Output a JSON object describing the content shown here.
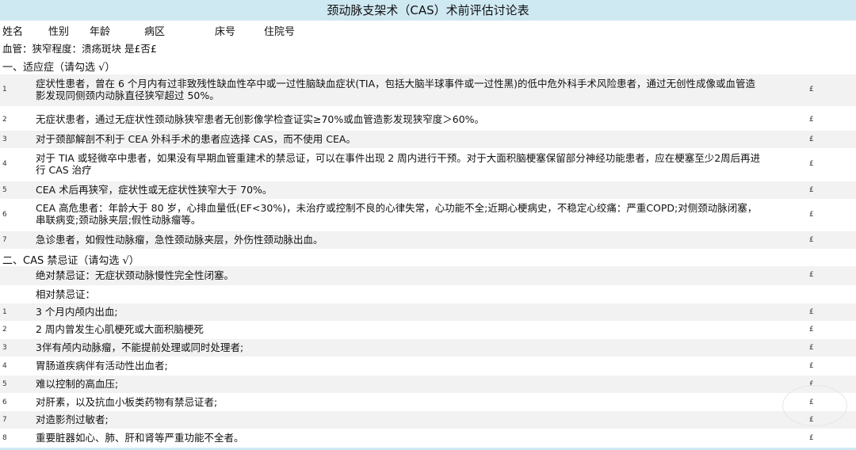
{
  "title": "颈动脉支架术（CAS）术前评估讨论表",
  "header": {
    "name": "姓名",
    "gender": "性别",
    "age": "年龄",
    "ward": "病区",
    "bed": "床号",
    "admission": "住院号"
  },
  "vessel_line": "血管：狭窄程度：溃疡斑块 是£否£",
  "indications": {
    "heading": "一、适应症（请勾选 √）",
    "items": [
      {
        "num": "1",
        "text": "症状性患者，曾在 6 个月内有过非致残性缺血性卒中或一过性脑缺血症状(TIA，包括大脑半球事件或一过性黑)的低中危外科手术风险患者，通过无创性成像或血管造影发现同侧颈内动脉直径狭窄超过 50%。",
        "check": "£"
      },
      {
        "num": "2",
        "text": "无症状患者，通过无症状性颈动脉狭窄患者无创影像学检查证实≥70%或血管造影发现狭窄度＞60%。",
        "check": "£"
      },
      {
        "num": "3",
        "text": "对于颈部解剖不利于 CEA 外科手术的患者应选择 CAS，而不使用 CEA。",
        "check": "£"
      },
      {
        "num": "4",
        "text": "对于 TIA 或轻微卒中患者，如果没有早期血管重建术的禁忌证，可以在事件出现 2 周内进行干预。对于大面积脑梗塞保留部分神经功能患者，应在梗塞至少2周后再进行 CAS 治疗",
        "check": "£"
      },
      {
        "num": "5",
        "text": "CEA 术后再狭窄，症状性或无症状性狭窄大于 70%。",
        "check": "£"
      },
      {
        "num": "6",
        "text": "CEA 高危患者：年龄大于 80 岁，心排血量低(EF<30%)，未治疗或控制不良的心律失常，心功能不全;近期心梗病史，不稳定心绞痛：严重COPD;对侧颈动脉闭塞，串联病变;颈动脉夹层;假性动脉瘤等。",
        "check": "£"
      },
      {
        "num": "7",
        "text": "急诊患者，如假性动脉瘤，急性颈动脉夹层，外伤性颈动脉出血。",
        "check": "£"
      }
    ]
  },
  "contraindications": {
    "heading": "二、CAS 禁忌证（请勾选 √）",
    "absolute": {
      "text": "绝对禁忌证：无症状颈动脉慢性完全性闭塞。",
      "check": "£"
    },
    "relative_label": "相对禁忌证：",
    "items": [
      {
        "num": "1",
        "text": "3 个月内颅内出血;",
        "check": "£"
      },
      {
        "num": "2",
        "text": "2 周内曾发生心肌梗死或大面积脑梗死",
        "check": "£"
      },
      {
        "num": "3",
        "text": "3伴有颅内动脉瘤，不能提前处理或同时处理者;",
        "check": "£"
      },
      {
        "num": "4",
        "text": "胃肠道疾病伴有活动性出血者;",
        "check": "£"
      },
      {
        "num": "5",
        "text": "难以控制的高血压;",
        "check": "£"
      },
      {
        "num": "6",
        "text": "对肝素，以及抗血小板类药物有禁忌证者;",
        "check": "£"
      },
      {
        "num": "7",
        "text": "对造影剂过敏者;",
        "check": "£"
      },
      {
        "num": "8",
        "text": "重要脏器如心、肺、肝和肾等严重功能不全者。",
        "check": "£"
      }
    ]
  }
}
